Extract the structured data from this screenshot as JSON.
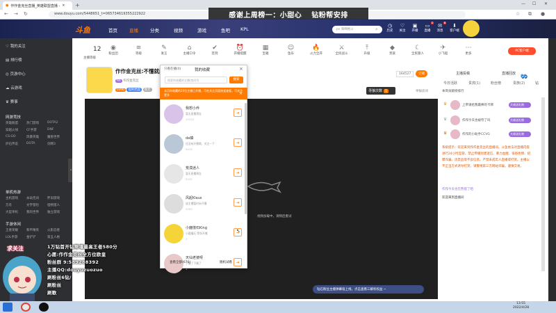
{
  "browser": {
    "tab_title": "作作金克丝直播_英雄联盟直播 - ",
    "url": "www.douyu.com/5448651_t=065734619355222922"
  },
  "banner": {
    "left": "感谢上周榜一：小甜心",
    "right": "钻粉帮安排"
  },
  "site": {
    "logo": "斗鱼",
    "nav": [
      "首页",
      "直播",
      "分类",
      "视频",
      "游戏",
      "鱼吧",
      "KPL"
    ],
    "search_placeholder": "ps 海绵格斗",
    "header_icons": [
      {
        "label": "历史",
        "badge": ""
      },
      {
        "label": "关注",
        "badge": ""
      },
      {
        "label": "开播",
        "badge": ""
      },
      {
        "label": "直播",
        "badge": "2"
      },
      {
        "label": "消息",
        "badge": "8"
      },
      {
        "label": "客户端",
        "badge": ""
      },
      {
        "label": "用户",
        "badge": ""
      }
    ]
  },
  "sidebar": {
    "items": [
      "我的关注",
      "排行榜",
      "页游中心",
      "云游戏",
      "赛事"
    ],
    "sections": [
      {
        "title": "网游竞技",
        "grid": [
          "英雄联盟",
          "热门游戏",
          "DOTA2",
          "穿越火线",
          "CF手游",
          "DNF",
          "CS:GO",
          "风暴英雄",
          "魔兽世界",
          "炉石传说",
          "DOTA",
          "剑网3"
        ]
      },
      {
        "title": "单机热游",
        "grid": [
          "主机游戏",
          "永劫无间",
          "怀旧游戏",
          "方舟",
          "文字冒险",
          "怪物猎人",
          "大型单机",
          "我的世界",
          "独立游戏"
        ]
      },
      {
        "title": "手游休闲",
        "grid": [
          "王者荣耀",
          "和平精英",
          "火影忍者",
          "LOL手游",
          "金铲铲",
          "第五人格"
        ]
      }
    ]
  },
  "toolbar": {
    "level": "12",
    "items": [
      "主播等级",
      "粉丝团",
      "等级",
      "发言",
      "主播口令",
      "签到",
      "开播提醒",
      "宝箱",
      "鱼乐",
      "火力全开",
      "全民战斗",
      "升级",
      "贵族",
      "全民狼人",
      "小飞船",
      "更多"
    ],
    "pc_button": "PC客户端"
  },
  "stream": {
    "title": "作作金克丝:不懂就问",
    "uploader": "作作金克丝",
    "level_tag": "66",
    "tags": [
      "LV66",
      "福利档案",
      "暂无"
    ],
    "hotness": "2.3万",
    "fans": "164527",
    "subscribe_label": "订阅",
    "room_num_label": "寻狼次数",
    "room_num": "1",
    "report": "举报房间",
    "video_notice": "视频加载中，请稍后重试"
  },
  "popover": {
    "tab_left": "只看在播(0)",
    "tab_right": "我的收藏",
    "close": "×",
    "search_placeholder": "搜索你收藏的主播/房间号",
    "search_button": "搜索",
    "notice": "本月你收藏的20位主播已开播，可在关注页面快速查看，可关注更多",
    "favorites": [
      {
        "name": "我想小乔",
        "desc": "暂无直播预告",
        "stat": "10115",
        "color": "#d9c3e8"
      },
      {
        "name": "da镇",
        "desc": "还没有开播哦，关注一下",
        "stat": "9415",
        "color": "#b9c7d6"
      },
      {
        "name": "荒漠迷人",
        "desc": "暂无直播预告",
        "stat": "5225",
        "color": "#e6e6e6"
      },
      {
        "name": "风起Klaus",
        "desc": "该主播暂时未开播",
        "stat": "2005",
        "color": "#ddd"
      },
      {
        "name": "小鹿撞石King",
        "desc": "小鹿撞石 等你开播",
        "stat": "3",
        "color": "#f5d43a"
      },
      {
        "name": "天仙老婆呀",
        "desc": "下播了下播了",
        "stat": "1",
        "color": "#e8c8c8"
      }
    ],
    "footer_left": "查看全部(670)",
    "footer_right": "随机试看"
  },
  "right_panel": {
    "tabs": [
      "主播投稿",
      "直播回放"
    ],
    "subtabs": [
      "今日活跃",
      "贵宾(1)",
      "粉丝榜",
      "贵族(2)",
      "钻"
    ],
    "rank_title": "本周贡献榜排行",
    "ranks": [
      {
        "name": "上帝请给我最棒的卡牌",
        "btn": "大佬送礼物"
      },
      {
        "name": "作作今天也被夸了吗",
        "btn": "大佬送礼物"
      },
      {
        "name": "作作的小助手CCVG",
        "btn": "大佬送礼物"
      }
    ],
    "chat": [
      {
        "type": "sys",
        "text": "系统提示：欢迎来到作作金克丝的直播间。斗鱼依法对直播内容进行24小时监管，禁止传播封建迷信、暴力血腥、低俗色情、招嫖诈骗、违禁品等不良信息。严禁未成年人直播或打赏。主播以不正当方式诱导打赏，请警惕第三方网站诈骗，谨慎交易。"
      },
      {
        "type": "msg",
        "text": "作作今天也在熬夜了哈"
      },
      {
        "type": "msg",
        "text": "欢迎来到直播间"
      }
    ],
    "danmu": "钻石粉丝主播弹幕墙上线，点击查看三解析权益 ~"
  },
  "overlay": {
    "lines": [
      "1万钻首开钻帮墙最高王者580分",
      "心愿:作作金克丝全方位欧皇",
      "粉丝群 9:589288392",
      "主播QQ:douyuzuozuo",
      "刷粉丝6钻/",
      "刷粉丝",
      "刷歌"
    ],
    "shout": "求关注"
  },
  "taskbar": {
    "time": "13:55",
    "date": "2022/4/28"
  }
}
